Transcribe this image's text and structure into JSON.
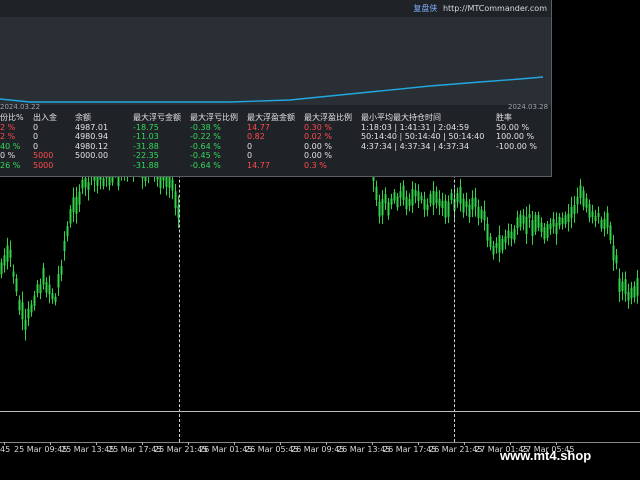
{
  "header": {
    "brand": "复盘侠",
    "url": "http://MTCommander.com"
  },
  "mini_chart": {
    "start_date": "2024.03.22",
    "end_date": "2024.03.28",
    "line_color": "#22a7e0"
  },
  "stats": {
    "headers": [
      "份比%",
      "出入金",
      "余额",
      "最大浮亏金额",
      "最大浮亏比例",
      "最大浮盈金额",
      "最大浮盈比例",
      "最小平均最大持仓时间",
      "胜率"
    ],
    "rows": [
      [
        "2 %",
        "0",
        "4987.01",
        "-18.75",
        "-0.38 %",
        "14.77",
        "0.30 %",
        "1:18:03 | 1:41:31 | 2:04:59",
        "50.00 %"
      ],
      [
        "2 %",
        "0",
        "4980.94",
        "-11.03",
        "-0.22 %",
        "0.82",
        "0.02 %",
        "50:14:40 | 50:14:40 | 50:14:40",
        "100.00 %"
      ],
      [
        "40 %",
        "0",
        "4980.12",
        "-31.88",
        "-0.64 %",
        "0",
        "0.00 %",
        "4:37:34 | 4:37:34 | 4:37:34",
        "-100.00 %"
      ],
      [
        "0 %",
        "5000",
        "5000.00",
        "-22.35",
        "-0.45 %",
        "0",
        "0.00 %",
        "",
        ""
      ],
      [
        "26 %",
        "5000",
        "",
        "-31.88",
        "-0.64 %",
        "14.77",
        "0.3 %",
        "",
        ""
      ]
    ]
  },
  "time_axis": {
    "labels": [
      "45",
      "25 Mar 09:45",
      "25 Mar 13:45",
      "25 Mar 17:45",
      "25 Mar 21:45",
      "26 Mar 01:45",
      "26 Mar 05:45",
      "26 Mar 09:45",
      "26 Mar 13:45",
      "26 Mar 17:45",
      "26 Mar 21:45",
      "27 Mar 01:45",
      "27 Mar 05:45"
    ]
  },
  "watermark": "www.mt4.shop",
  "colors": {
    "candle": "#33d24a",
    "background": "#000000",
    "panel": "#1f2227"
  }
}
